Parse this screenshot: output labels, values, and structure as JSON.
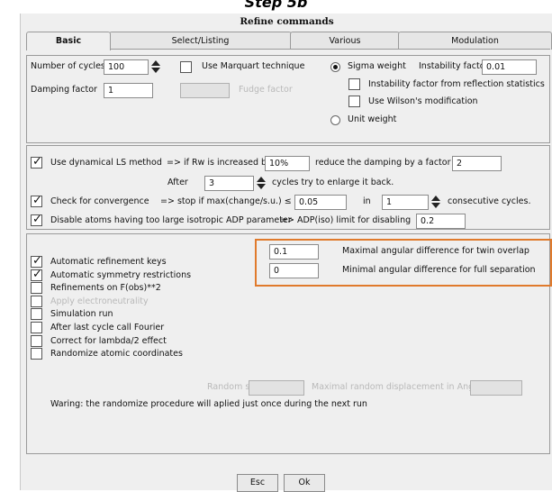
{
  "caption": "Step 5b",
  "window": {
    "title": "Refine commands"
  },
  "tabs": [
    "Basic",
    "Select/Listing",
    "Various",
    "Modulation"
  ],
  "cycles": {
    "label": "Number of cycles",
    "value": "100",
    "damping_label": "Damping factor",
    "damping_value": "1",
    "marquart_label": "Use Marquart technique",
    "fudge_label": "Fudge factor",
    "fudge_value": ""
  },
  "weights": {
    "sigma_label": "Sigma weight",
    "instability_label": "Instability factor",
    "instability_value": "0.01",
    "instab_stats_label": "Instability factor from reflection statistics",
    "wilson_label": "Use Wilson's modification",
    "unit_label": "Unit weight"
  },
  "dynamical": {
    "label": "Use dynamical LS method",
    "rw_text": "=> if Rw is increased by",
    "rw_value": "10%",
    "reduce_text": "reduce the damping by a factor",
    "factor_value": "2",
    "after_label": "After",
    "after_value": "3",
    "cycles_text": "cycles try to enlarge it back."
  },
  "convergence": {
    "label": "Check for convergence",
    "stop_text": "=> stop if max(change/s.u.) ≤",
    "max_value": "0.05",
    "in_label": "in",
    "in_value": "1",
    "consec_label": "consecutive cycles."
  },
  "adp": {
    "label": "Disable atoms having too large isotropic ADP parameter",
    "limit_text": "=> ADP(iso) limit for disabling",
    "limit_value": "0.2"
  },
  "twin": {
    "overlap_value": "0.1",
    "overlap_label": "Maximal angular difference for twin overlap",
    "separation_value": "0",
    "separation_label": "Minimal angular difference for full separation"
  },
  "options": [
    {
      "label": "Automatic refinement keys",
      "checked": true,
      "disabled": false
    },
    {
      "label": "Automatic symmetry restrictions",
      "checked": true,
      "disabled": false
    },
    {
      "label": "Refinements on F(obs)**2",
      "checked": false,
      "disabled": false
    },
    {
      "label": "Apply electroneutrality",
      "checked": false,
      "disabled": true
    },
    {
      "label": "Simulation run",
      "checked": false,
      "disabled": false
    },
    {
      "label": "After last cycle call Fourier",
      "checked": false,
      "disabled": false
    },
    {
      "label": "Correct for lambda/2 effect",
      "checked": false,
      "disabled": false
    },
    {
      "label": "Randomize atomic coordinates",
      "checked": false,
      "disabled": false
    }
  ],
  "random": {
    "seed_label": "Random seed",
    "displacement_label": "Maximal random displacement in Ang",
    "warning": "Waring: the randomize procedure will aplied just once during the next run"
  },
  "buttons": {
    "esc": "Esc",
    "ok": "Ok"
  }
}
